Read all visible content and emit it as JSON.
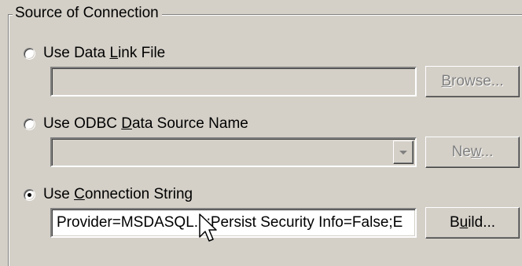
{
  "group": {
    "legend": "Source of Connection"
  },
  "options": {
    "data_link_file": {
      "prefix": "Use Data ",
      "accel": "L",
      "suffix": "ink File",
      "checked": false,
      "field_value": "",
      "button": {
        "prefix": "",
        "accel": "B",
        "suffix": "rowse...",
        "enabled": false
      }
    },
    "odbc_dsn": {
      "prefix": "Use ODBC ",
      "accel": "D",
      "suffix": "ata Source Name",
      "checked": false,
      "field_value": "",
      "button": {
        "prefix": "Ne",
        "accel": "w",
        "suffix": "...",
        "enabled": false
      }
    },
    "connection_string": {
      "prefix": "Use ",
      "accel": "C",
      "suffix": "onnection String",
      "checked": true,
      "field_value": "Provider=MSDASQL.1;Persist Security Info=False;E",
      "button": {
        "prefix": "B",
        "accel": "u",
        "suffix": "ild...",
        "enabled": true
      }
    }
  },
  "icons": {
    "combo_arrow": "chevron-down-icon",
    "pointer": "mouse-pointer-icon"
  },
  "colors": {
    "face": "#d4d0c8",
    "shadow": "#808080",
    "highlight": "#ffffff",
    "disabled_text": "#808080"
  }
}
